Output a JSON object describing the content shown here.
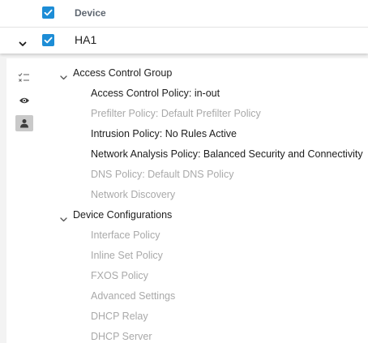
{
  "header": {
    "column_label": "Device"
  },
  "device": {
    "name": "HA1"
  },
  "groups": [
    {
      "label": "Access Control Group",
      "items": [
        {
          "label": "Access Control Policy: in-out",
          "active": true
        },
        {
          "label": "Prefilter Policy: Default Prefilter Policy",
          "active": false
        },
        {
          "label": "Intrusion Policy: No Rules Active",
          "active": true
        },
        {
          "label": "Network Analysis Policy: Balanced Security and Connectivity",
          "active": true
        },
        {
          "label": "DNS Policy: Default DNS Policy",
          "active": false
        },
        {
          "label": "Network Discovery",
          "active": false
        }
      ]
    },
    {
      "label": "Device Configurations",
      "items": [
        {
          "label": "Interface Policy",
          "active": false
        },
        {
          "label": "Inline Set Policy",
          "active": false
        },
        {
          "label": "FXOS Policy",
          "active": false
        },
        {
          "label": "Advanced Settings",
          "active": false
        },
        {
          "label": "DHCP Relay",
          "active": false
        },
        {
          "label": "DHCP Server",
          "active": false
        }
      ]
    }
  ],
  "colors": {
    "checkbox": "#1d8dd6",
    "active_text": "#1d1d1d",
    "inactive_text": "#a9a9a9"
  },
  "icons": [
    "checklist-icon",
    "eye-icon",
    "user-icon",
    "chevron-down-icon",
    "checkmark-icon"
  ]
}
